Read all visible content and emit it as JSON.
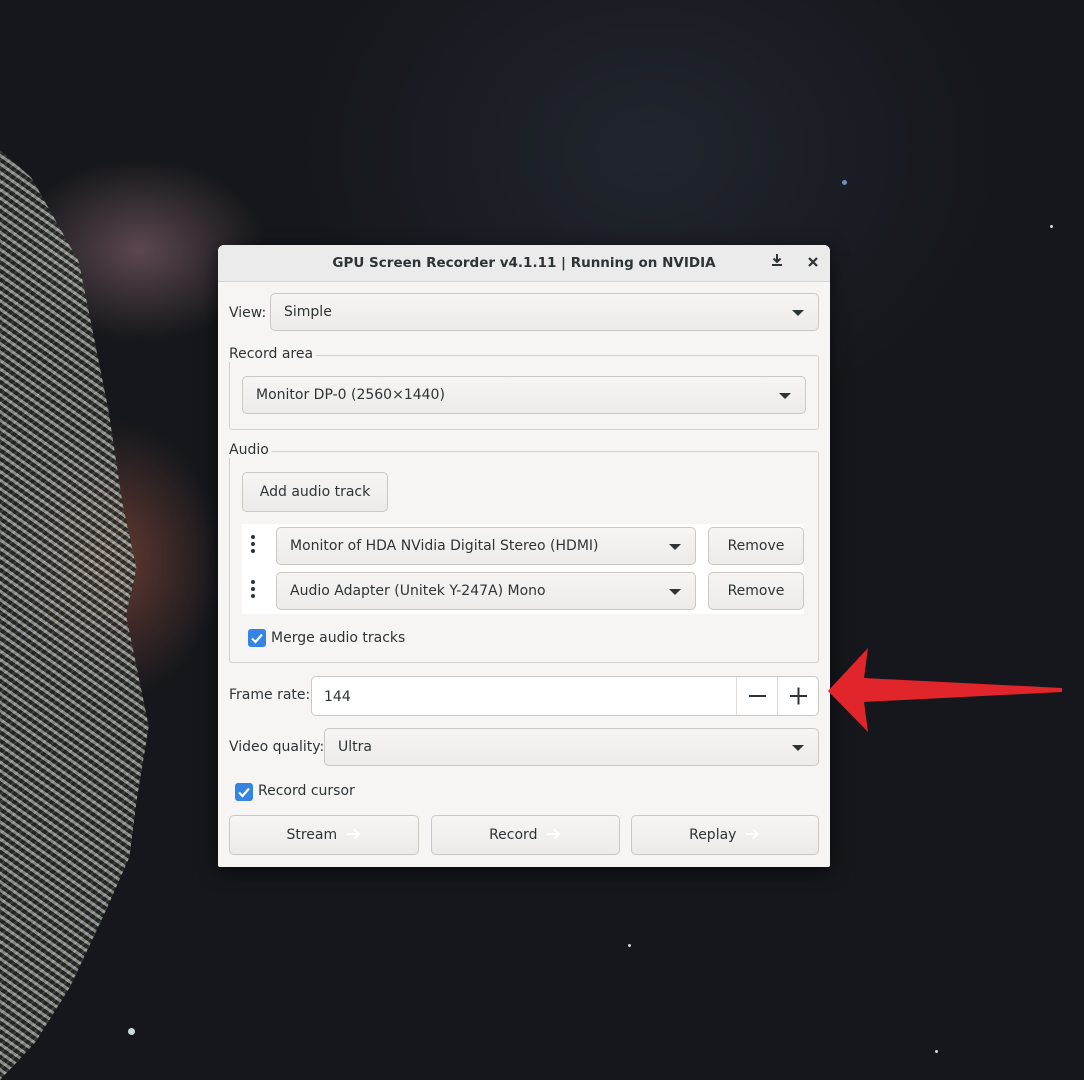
{
  "window": {
    "title": "GPU Screen Recorder v4.1.11 | Running on NVIDIA"
  },
  "view": {
    "label": "View:",
    "value": "Simple"
  },
  "record_area": {
    "label": "Record area",
    "value": "Monitor DP-0 (2560×1440)"
  },
  "audio": {
    "label": "Audio",
    "add_track_label": "Add audio track",
    "tracks": [
      {
        "device": "Monitor of HDA NVidia Digital Stereo (HDMI)",
        "remove_label": "Remove"
      },
      {
        "device": "Audio Adapter (Unitek Y-247A) Mono",
        "remove_label": "Remove"
      }
    ],
    "merge_label": "Merge audio tracks",
    "merge_checked": true
  },
  "frame_rate": {
    "label": "Frame rate:",
    "value": "144"
  },
  "video_quality": {
    "label": "Video quality:",
    "value": "Ultra"
  },
  "record_cursor": {
    "label": "Record cursor",
    "checked": true
  },
  "actions": {
    "stream_label": "Stream",
    "record_label": "Record",
    "replay_label": "Replay"
  },
  "colors": {
    "accent": "#3584e4",
    "annotation_arrow": "#e0252b"
  },
  "icons": [
    "download-icon",
    "close-icon",
    "chevron-down-icon",
    "drag-handle-icon",
    "minus-icon",
    "plus-icon",
    "arrow-right-icon",
    "checkmark-icon"
  ]
}
